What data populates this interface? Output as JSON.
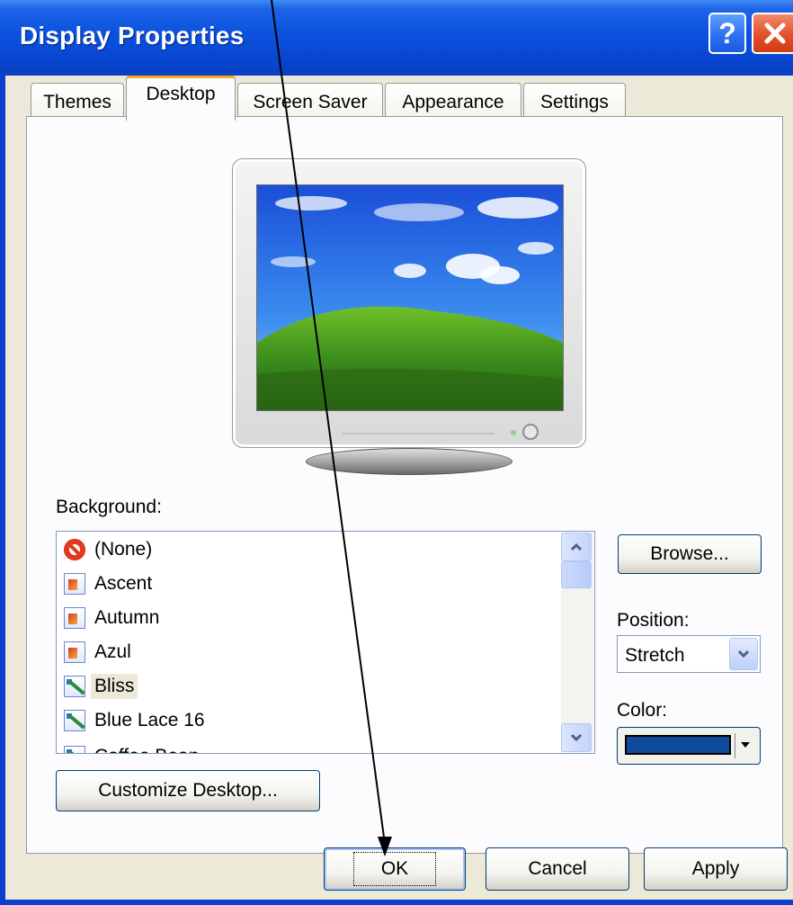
{
  "window": {
    "title": "Display Properties",
    "help_glyph": "?",
    "close_glyph": "x"
  },
  "tabs": [
    {
      "label": "Themes",
      "active": false
    },
    {
      "label": "Desktop",
      "active": true
    },
    {
      "label": "Screen Saver",
      "active": false
    },
    {
      "label": "Appearance",
      "active": false
    },
    {
      "label": "Settings",
      "active": false
    }
  ],
  "preview": {
    "wallpaper": "Bliss"
  },
  "background": {
    "label": "Background:",
    "items": [
      {
        "label": "(None)",
        "icon": "no-icon"
      },
      {
        "label": "Ascent",
        "icon": "picture-icon"
      },
      {
        "label": "Autumn",
        "icon": "picture-icon"
      },
      {
        "label": "Azul",
        "icon": "picture-icon"
      },
      {
        "label": "Bliss",
        "icon": "paint-icon",
        "selected": true
      },
      {
        "label": "Blue Lace 16",
        "icon": "paint-icon"
      },
      {
        "label": "Coffee Bean",
        "icon": "paint-icon"
      }
    ]
  },
  "browse_button": "Browse...",
  "position": {
    "label": "Position:",
    "value": "Stretch"
  },
  "color": {
    "label": "Color:",
    "value": "#0f4a9c"
  },
  "customize_button": "Customize Desktop...",
  "footer": {
    "ok": "OK",
    "cancel": "Cancel",
    "apply": "Apply"
  },
  "colors": {
    "titlebar": "#0a52de",
    "dialog_bg": "#ece9d8",
    "tab_accent": "#f7a424"
  }
}
